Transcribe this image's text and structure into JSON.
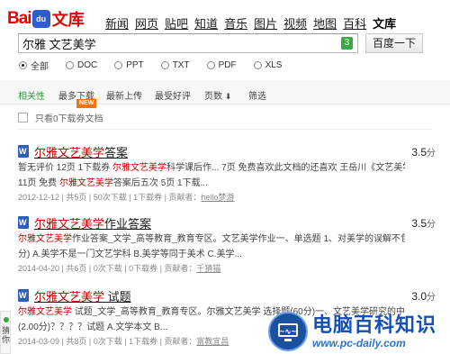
{
  "logo": {
    "bai": "Bai",
    "paw": "du",
    "wenku": "文库"
  },
  "nav": [
    "新闻",
    "网页",
    "贴吧",
    "知道",
    "音乐",
    "图片",
    "视频",
    "地图",
    "百科",
    "文库"
  ],
  "search": {
    "query": "尔雅 文艺美学",
    "badge": "3",
    "button": "百度一下"
  },
  "filetypes": [
    {
      "label": "全部",
      "selected": true
    },
    {
      "label": "DOC",
      "selected": false
    },
    {
      "label": "PPT",
      "selected": false
    },
    {
      "label": "TXT",
      "selected": false
    },
    {
      "label": "PDF",
      "selected": false
    },
    {
      "label": "XLS",
      "selected": false
    }
  ],
  "sort": {
    "relevance": "相关性",
    "most_downloads": "最多下载",
    "newest": "最新上传",
    "best_rated": "最受好评",
    "pages": "页数",
    "filter": "筛选",
    "new_tag": "NEW"
  },
  "only_free": "只看0下载券文档",
  "results": [
    {
      "title_hl": "尔雅文艺美学",
      "title_rest": "答案",
      "score": "3.5",
      "score_unit": "分",
      "snippet1_a": "暂无评价 12页 1下载券 ",
      "snippet1_hl": "尔雅文艺美学",
      "snippet1_b": "科学课后作... 7页 免费喜欢此文档的还喜欢 王岳川《文艺美学》作业...",
      "snippet2_a": "11页 免费 ",
      "snippet2_hl": "尔雅文艺美学",
      "snippet2_b": "答案后五次 5页 1下载...",
      "meta_a": "2012-12-12 | 共5页 | 50次下载 | 1下载券 | 贡献者：",
      "uploader": "hello梦游"
    },
    {
      "title_hl": "尔雅文艺美学",
      "title_rest": "作业答案",
      "score": "3.5",
      "score_unit": "分",
      "snippet1_a": "",
      "snippet1_hl": "尔雅文艺美学",
      "snippet1_b": "作业答案_文学_高等教育_教育专区。文艺美学作业一、单选题 1、对美学的误解不包括 (6.00",
      "snippet2_a": "分) A.美学不是一门文艺学科 B.美学等同于美术 C.美学...",
      "snippet2_hl": "",
      "snippet2_b": "",
      "meta_a": "2014-04-20 | 共6页 | 0次下载 | 0下载券 | 贡献者：",
      "uploader": "千猜猫"
    },
    {
      "title_hl": "尔雅文艺美学",
      "title_rest": " 试题",
      "score": "3.0",
      "score_unit": "分",
      "snippet1_a": "",
      "snippet1_hl": "尔雅文艺美学",
      "snippet1_b": " 试题_文学_高等教育_教育专区。尔雅文艺美学 选择题(60分)一、文艺美学研究的中心",
      "snippet2_a": "(2.00分)？？？？试题 A.文学本文 B...",
      "snippet2_hl": "",
      "snippet2_b": "",
      "meta_a": "2014-03-09 | 共8页 | 0次下载 | 1下载券 | 贡献者：",
      "uploader": "富教宜昌"
    }
  ],
  "watermark": {
    "title": "电脑百科知识",
    "url": "www.pc-daily.com"
  },
  "side_widget": {
    "label": "猜你"
  }
}
